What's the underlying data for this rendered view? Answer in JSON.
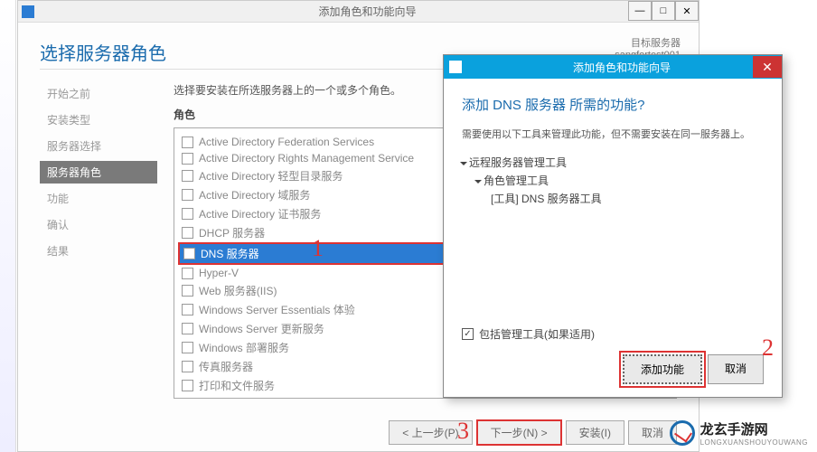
{
  "main_window": {
    "title": "添加角色和功能向导",
    "page_title": "选择服务器角色",
    "server_label": "目标服务器",
    "server_name": "sangfortest001",
    "instruction": "选择要安装在所选服务器上的一个或多个角色。",
    "roles_label": "角色",
    "sidebar": [
      "开始之前",
      "安装类型",
      "服务器选择",
      "服务器角色",
      "功能",
      "确认",
      "结果"
    ],
    "sidebar_active_index": 3,
    "roles": [
      "Active Directory Federation Services",
      "Active Directory Rights Management Service",
      "Active Directory 轻型目录服务",
      "Active Directory 域服务",
      "Active Directory 证书服务",
      "DHCP 服务器",
      "DNS 服务器",
      "Hyper-V",
      "Web 服务器(IIS)",
      "Windows Server Essentials 体验",
      "Windows Server 更新服务",
      "Windows 部署服务",
      "传真服务器",
      "打印和文件服务"
    ],
    "highlighted_role_index": 6,
    "footer": {
      "prev": "< 上一步(P)",
      "next": "下一步(N) >",
      "install": "安装(I)",
      "cancel": "取消"
    }
  },
  "popup": {
    "title": "添加角色和功能向导",
    "heading": "添加 DNS 服务器 所需的功能?",
    "description": "需要使用以下工具来管理此功能，但不需要安装在同一服务器上。",
    "tree": {
      "l1": "远程服务器管理工具",
      "l2": "角色管理工具",
      "l3": "[工具] DNS 服务器工具"
    },
    "include_tools": "包括管理工具(如果适用)",
    "include_checked": true,
    "add_btn": "添加功能",
    "cancel_btn": "取消"
  },
  "annotations": {
    "n1": "1",
    "n2": "2",
    "n3": "3"
  },
  "watermark": {
    "cn": "龙玄手游网",
    "en": "LONGXUANSHOUYOUWANG"
  }
}
